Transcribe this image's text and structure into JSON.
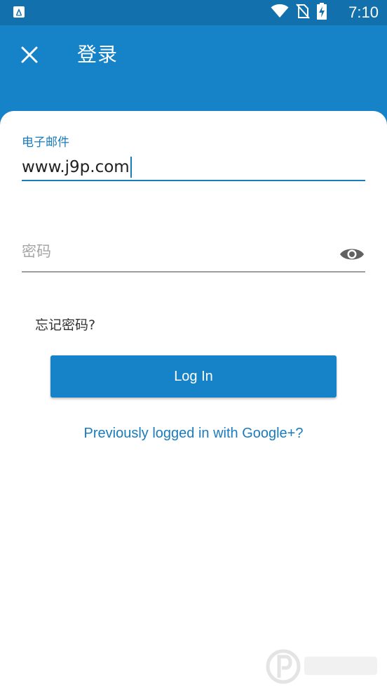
{
  "status_bar": {
    "time": "7:10",
    "icons": [
      "app-notification-icon",
      "wifi-icon",
      "no-sim-icon",
      "battery-charging-icon"
    ]
  },
  "app_bar": {
    "title": "登录",
    "close_icon": "close-icon"
  },
  "form": {
    "email_label": "电子邮件",
    "email_value": "www.j9p.com",
    "password_placeholder": "密码",
    "toggle_visibility_icon": "eye-icon",
    "forgot_password": "忘记密码?",
    "login_button": "Log In",
    "google_link": "Previously logged in with Google+?"
  },
  "colors": {
    "primary": "#1682c7",
    "status_bar": "#1270ad",
    "link": "#1a7bbd"
  }
}
